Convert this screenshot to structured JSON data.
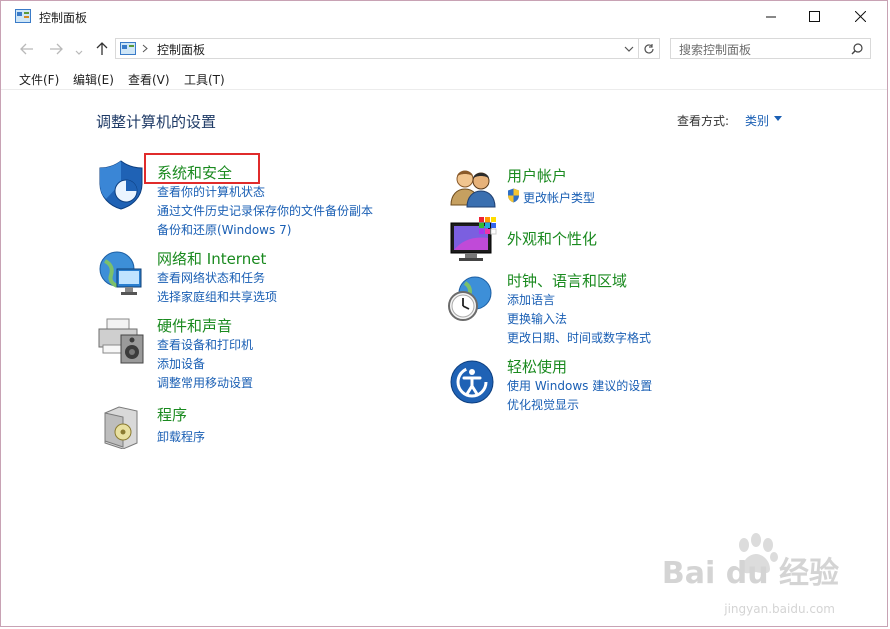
{
  "window": {
    "title": "控制面板"
  },
  "nav": {
    "breadcrumb": "控制面板",
    "search_placeholder": "搜索控制面板"
  },
  "menu": {
    "items": [
      "文件(F)",
      "编辑(E)",
      "查看(V)",
      "工具(T)"
    ]
  },
  "main": {
    "heading": "调整计算机的设置",
    "view_by_label": "查看方式:",
    "view_by_value": "类别"
  },
  "categories": {
    "system_security": {
      "title": "系统和安全",
      "links": [
        "查看你的计算机状态",
        "通过文件历史记录保存你的文件备份副本",
        "备份和还原(Windows 7)"
      ]
    },
    "network": {
      "title": "网络和 Internet",
      "links": [
        "查看网络状态和任务",
        "选择家庭组和共享选项"
      ]
    },
    "hardware": {
      "title": "硬件和声音",
      "links": [
        "查看设备和打印机",
        "添加设备",
        "调整常用移动设置"
      ]
    },
    "programs": {
      "title": "程序",
      "links": [
        "卸载程序"
      ]
    },
    "user_accounts": {
      "title": "用户帐户",
      "links": [
        "更改帐户类型"
      ]
    },
    "appearance": {
      "title": "外观和个性化",
      "links": []
    },
    "clock": {
      "title": "时钟、语言和区域",
      "links": [
        "添加语言",
        "更换输入法",
        "更改日期、时间或数字格式"
      ]
    },
    "ease": {
      "title": "轻松使用",
      "links": [
        "使用 Windows 建议的设置",
        "优化视觉显示"
      ]
    }
  },
  "watermark": {
    "text": "Bai du 经验",
    "url": "jingyan.baidu.com"
  },
  "colors": {
    "category": "#1a8a1f",
    "link": "#1a5fb4",
    "highlight": "#e02b2b"
  }
}
